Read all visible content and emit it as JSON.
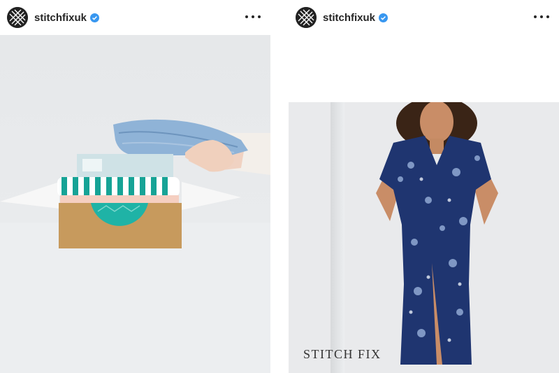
{
  "posts": [
    {
      "username": "stitchfixuk",
      "verified": true,
      "more_icon": "more-horizontal-icon"
    },
    {
      "username": "stitchfixuk",
      "verified": true,
      "more_icon": "more-horizontal-icon",
      "watermark": "STITCH FIX"
    }
  ],
  "colors": {
    "verified_blue": "#3897f0",
    "box_brown": "#c79a5d",
    "box_teal": "#1fb3a6",
    "dress_navy": "#1f3570"
  }
}
